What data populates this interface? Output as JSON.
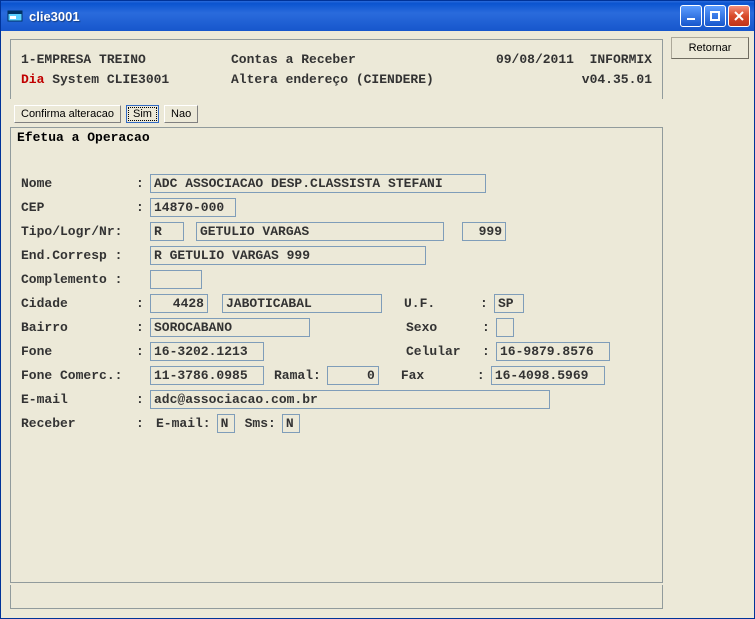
{
  "window": {
    "title": "clie3001"
  },
  "side": {
    "retornar": "Retornar"
  },
  "header": {
    "company": "1-EMPRESA TREINO",
    "module": "Contas a Receber",
    "date": "09/08/2011",
    "db": "INFORMIX",
    "dia": "Dia",
    "system": " System  CLIE3001",
    "action": "Altera endereço (CIENDERE)",
    "version": "v04.35.01"
  },
  "toolbar": {
    "confirma": "Confirma alteracao",
    "sim": "Sim",
    "nao": "Nao"
  },
  "status": "Efetua a Operacao",
  "labels": {
    "nome": "Nome",
    "cep": "CEP",
    "tipo_logr_nr": "Tipo/Logr/Nr:",
    "end_corresp": "End.Corresp :",
    "complemento": "Complemento :",
    "cidade": "Cidade",
    "uf": "U.F.",
    "bairro": "Bairro",
    "sexo": "Sexo",
    "fone": "Fone",
    "celular": "Celular",
    "fone_comerc": "Fone Comerc.:",
    "ramal": "Ramal:",
    "fax": "Fax",
    "email": "E-mail",
    "receber": "Receber",
    "receber_email": "E-mail:",
    "receber_sms": "Sms:"
  },
  "fields": {
    "nome": "ADC ASSOCIACAO DESP.CLASSISTA STEFANI",
    "cep": "14870-000",
    "tipo": "R",
    "logr": "GETULIO VARGAS",
    "nr": "999",
    "end_corresp": "R GETULIO VARGAS 999",
    "complemento": "",
    "cidade_cod": "4428",
    "cidade_nome": "JABOTICABAL",
    "uf": "SP",
    "bairro": "SOROCABANO",
    "sexo": "",
    "fone": "16-3202.1213",
    "celular": "16-9879.8576",
    "fone_comerc": "11-3786.0985",
    "ramal": "0",
    "fax": "16-4098.5969",
    "email": "adc@associacao.com.br",
    "receber_email": "N",
    "receber_sms": "N"
  }
}
